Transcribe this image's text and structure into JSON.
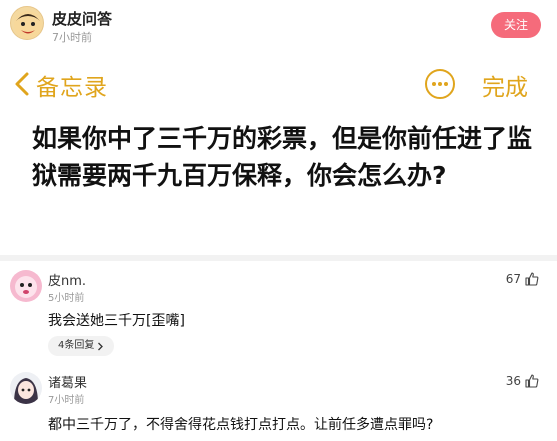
{
  "post": {
    "author": "皮皮问答",
    "time": "7小时前",
    "follow_label": "关注"
  },
  "memo_bar": {
    "back_label": "备忘录",
    "done_label": "完成"
  },
  "question": "如果你中了三千万的彩票，但是你前任进了监狱需要两千九百万保释，你会怎么办?",
  "comments": [
    {
      "name": "皮nm.",
      "time": "5小时前",
      "likes": "67",
      "text": "我会送她三千万[歪嘴]",
      "replies": "4条回复"
    },
    {
      "name": "诸葛果",
      "time": "7小时前",
      "likes": "36",
      "text": "都中三千万了，不得舍得花点钱打点打点。让前任多遭点罪吗?"
    }
  ],
  "colors": {
    "accent_yellow": "#e0a51d",
    "follow_pink": "#f56b7b"
  }
}
